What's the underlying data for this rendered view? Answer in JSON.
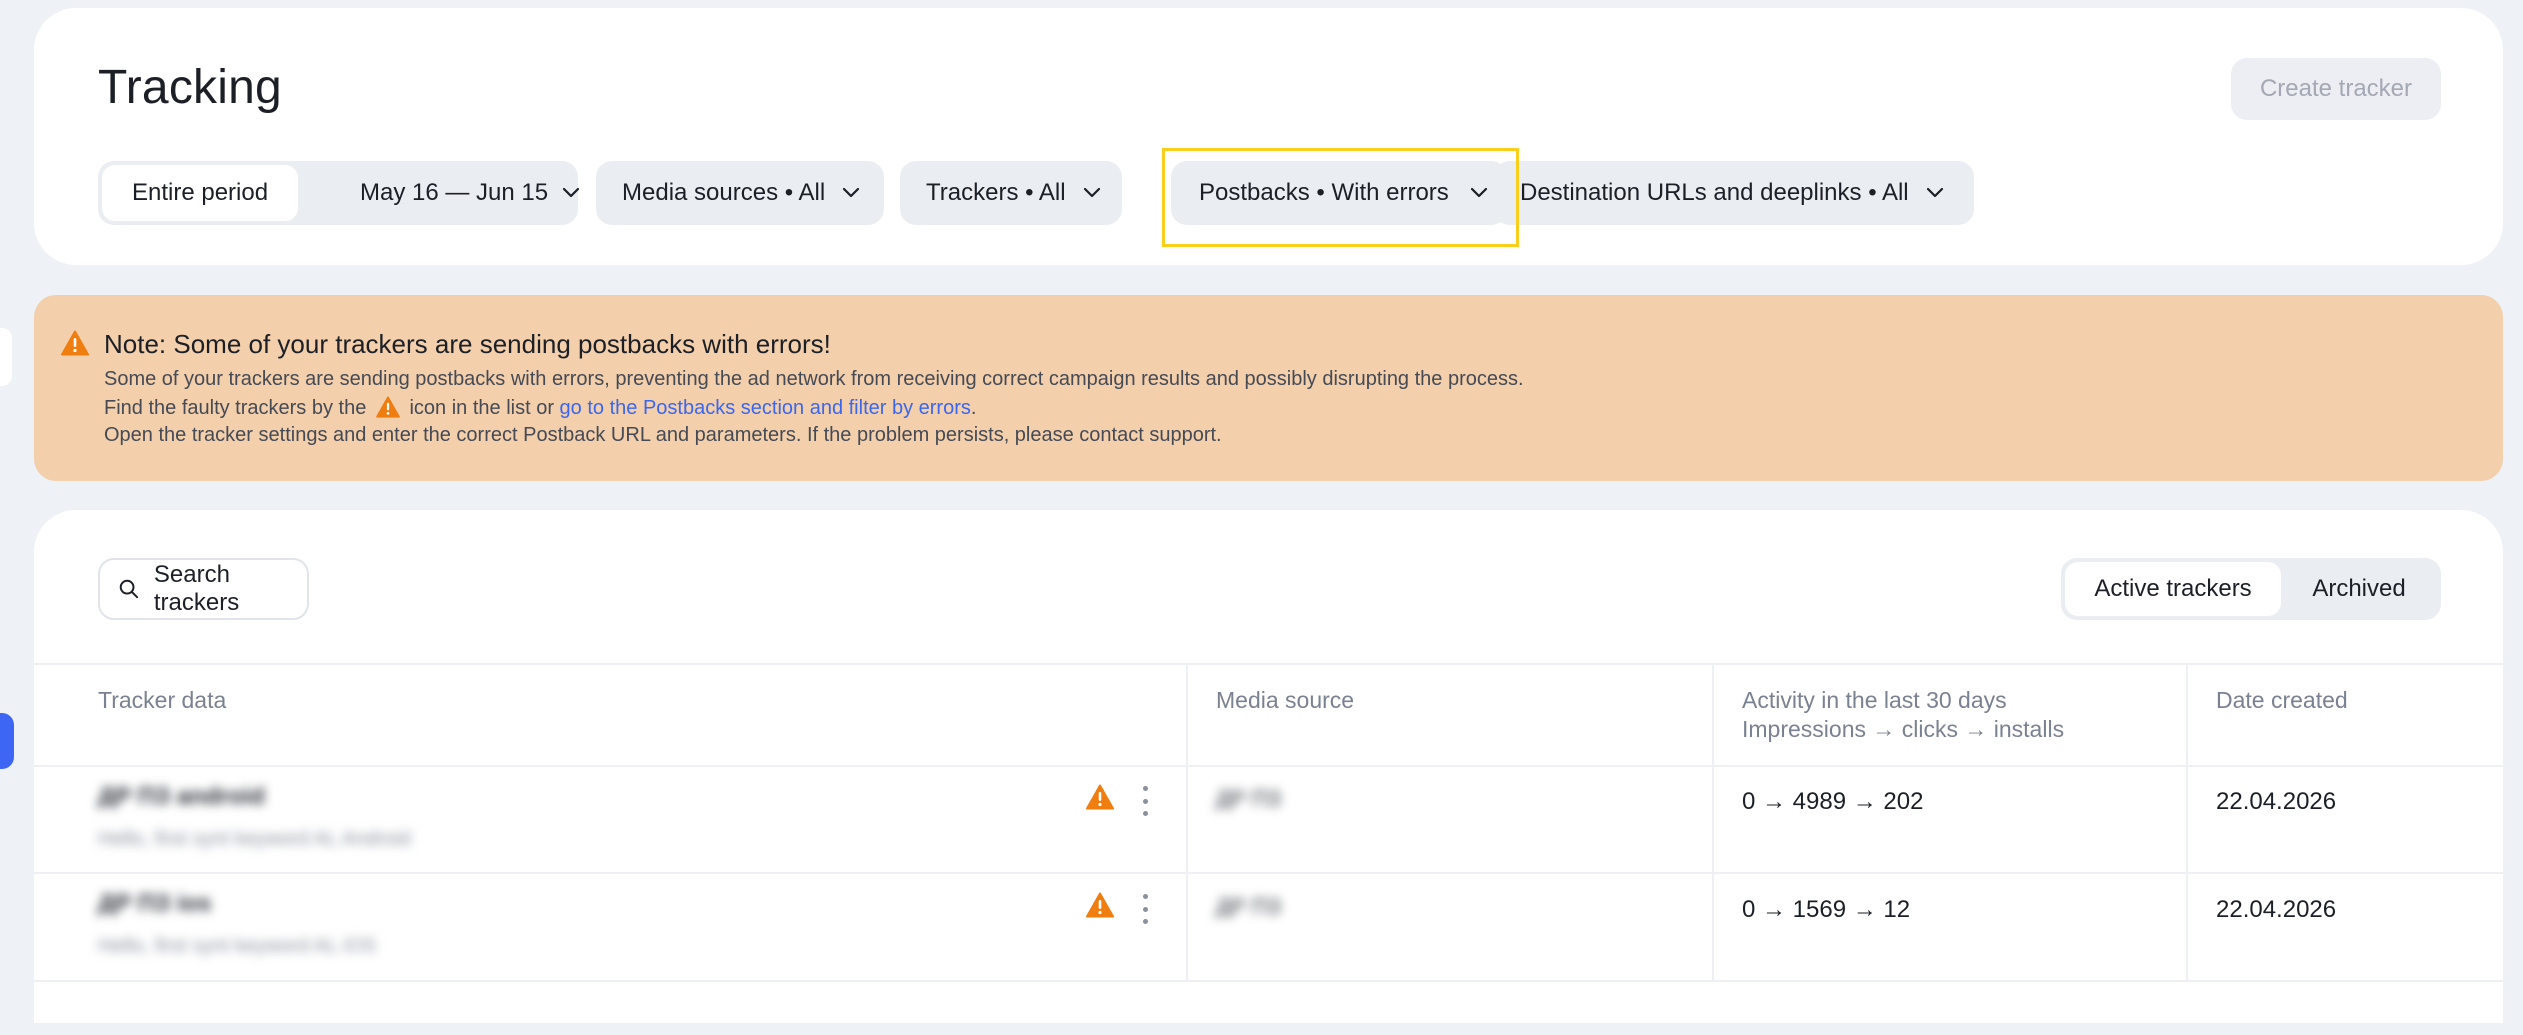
{
  "page": {
    "title": "Tracking",
    "create_button": "Create tracker"
  },
  "filters": {
    "period_segment": "Entire period",
    "date_range": "May 16 — Jun 15",
    "media_sources": "Media sources • All",
    "trackers": "Trackers • All",
    "postbacks": "Postbacks • With errors",
    "destinations": "Destination URLs and deeplinks • All"
  },
  "alert": {
    "title": "Note: Some of your trackers are sending postbacks with errors!",
    "line1": "Some of your trackers are sending postbacks with errors, preventing the ad network from receiving correct campaign results and possibly disrupting the process.",
    "line2_prefix": "Find the faulty trackers by the",
    "line2_middle": "icon in the list or",
    "line2_link": "go to the Postbacks section and filter by errors",
    "line2_suffix": ".",
    "line3": "Open the tracker settings and enter the correct Postback URL and parameters. If the problem persists, please contact support.",
    "background_color": "#f3cfab",
    "warning_color": "#f07d10"
  },
  "toolbar": {
    "search_placeholder": "Search trackers",
    "tab_active": "Active trackers",
    "tab_archived": "Archived"
  },
  "table": {
    "headers": {
      "tracker": "Tracker data",
      "media": "Media source",
      "activity_line1": "Activity in the last 30 days",
      "activity_line2": "Impressions → clicks → installs",
      "date": "Date created"
    },
    "rows": [
      {
        "name": "ДР ПЗ android",
        "subtitle": "Hello, first synt keyword AL Android",
        "media": "ДР ПЗ",
        "activity": "0 → 4989 → 202",
        "date": "22.04.2026"
      },
      {
        "name": "ДР ПЗ ios",
        "subtitle": "Hello, first synt keyword AL iOS",
        "media": "ДР ПЗ",
        "activity": "0 → 1569 → 12",
        "date": "22.04.2026"
      }
    ]
  },
  "colors": {
    "accent": "#3a67f0",
    "highlight_box": "#f7cf1c",
    "page_bg": "#eef1f6"
  }
}
